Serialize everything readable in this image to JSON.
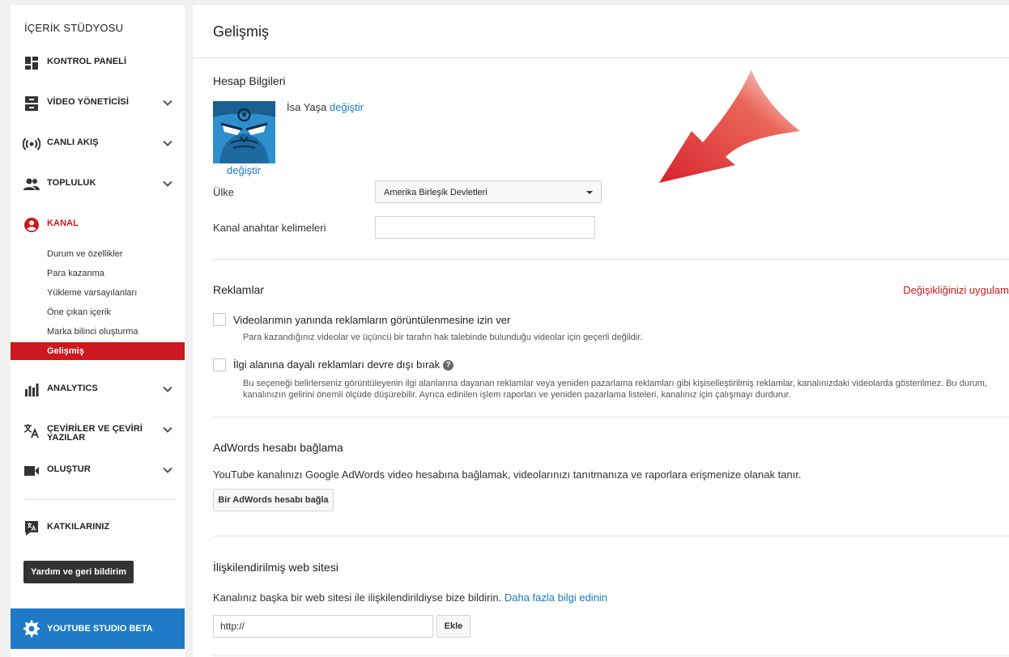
{
  "sidebar": {
    "title": "İÇERİK STÜDYOSU",
    "items": [
      {
        "label": "KONTROL PANELİ"
      },
      {
        "label": "VİDEO YÖNETİCİSİ"
      },
      {
        "label": "CANLI AKIŞ"
      },
      {
        "label": "TOPLULUK"
      },
      {
        "label": "KANAL"
      },
      {
        "label": "ANALYTICS"
      },
      {
        "label": "ÇEVİRİLER VE ÇEVİRİ YAZILAR"
      },
      {
        "label": "OLUŞTUR"
      },
      {
        "label": "KATKILARINIZ"
      }
    ],
    "channel_subitems": [
      {
        "label": "Durum ve özellikler"
      },
      {
        "label": "Para kazanma"
      },
      {
        "label": "Yükleme varsayılanları"
      },
      {
        "label": "Öne çıkan içerik"
      },
      {
        "label": "Marka bilinci oluşturma"
      },
      {
        "label": "Gelişmiş"
      }
    ],
    "help_button": "Yardım ve geri bildirim",
    "studio_beta": "YOUTUBE STUDIO BETA"
  },
  "main": {
    "page_title": "Gelişmiş",
    "account": {
      "section_title": "Hesap Bilgileri",
      "owner_name": "İsa Yaşa",
      "change_link": "değiştir",
      "avatar_change_link": "değiştir",
      "country_label": "Ülke",
      "country_value": "Amerika Birleşik Devletleri",
      "keywords_label": "Kanal anahtar kelimeleri",
      "keywords_value": ""
    },
    "ads": {
      "section_title": "Reklamlar",
      "apply_link": "Değişikliğinizi uygulam",
      "option1_label": "Videolarımın yanında reklamların görüntülenmesine izin ver",
      "option1_help": "Para kazandığınız videolar ve üçüncü bir tarafın hak talebinde bulunduğu videolar için geçerli değildir.",
      "option2_label": "İlgi alanına dayalı reklamları devre dışı bırak",
      "option2_help_icon": "?",
      "option2_help": "Bu seçeneği belirlerseniz görüntüleyenin ilgi alanlarına dayanan reklamlar veya yeniden pazarlama reklamları gibi kişiselleştirilmiş reklamlar, kanalınızdaki videolarda gösterilmez. Bu durum, kanalınızın gelirini önemli ölçüde düşürebilir. Ayrıca edinilen işlem raporları ve yeniden pazarlama listeleri, kanalınız için çalışmayı durdurur."
    },
    "adwords": {
      "section_title": "AdWords hesabı bağlama",
      "description": "YouTube kanalınızı Google AdWords video hesabına bağlamak, videolarınızı tanıtmanıza ve raporlara erişmenize olanak tanır.",
      "button": "Bir AdWords hesabı bağla"
    },
    "website": {
      "section_title": "İlişkilendirilmiş web sitesi",
      "description": "Kanalınız başka bir web sitesi ile ilişkilendirildiyse bize bildirin.",
      "learn_more": "Daha fazla bilgi edinin",
      "url_value": "http://",
      "add_button": "Ekle"
    }
  },
  "colors": {
    "accent_red": "#cc181e",
    "link_blue": "#167ac6",
    "beta_blue": "#1f7bc7"
  }
}
